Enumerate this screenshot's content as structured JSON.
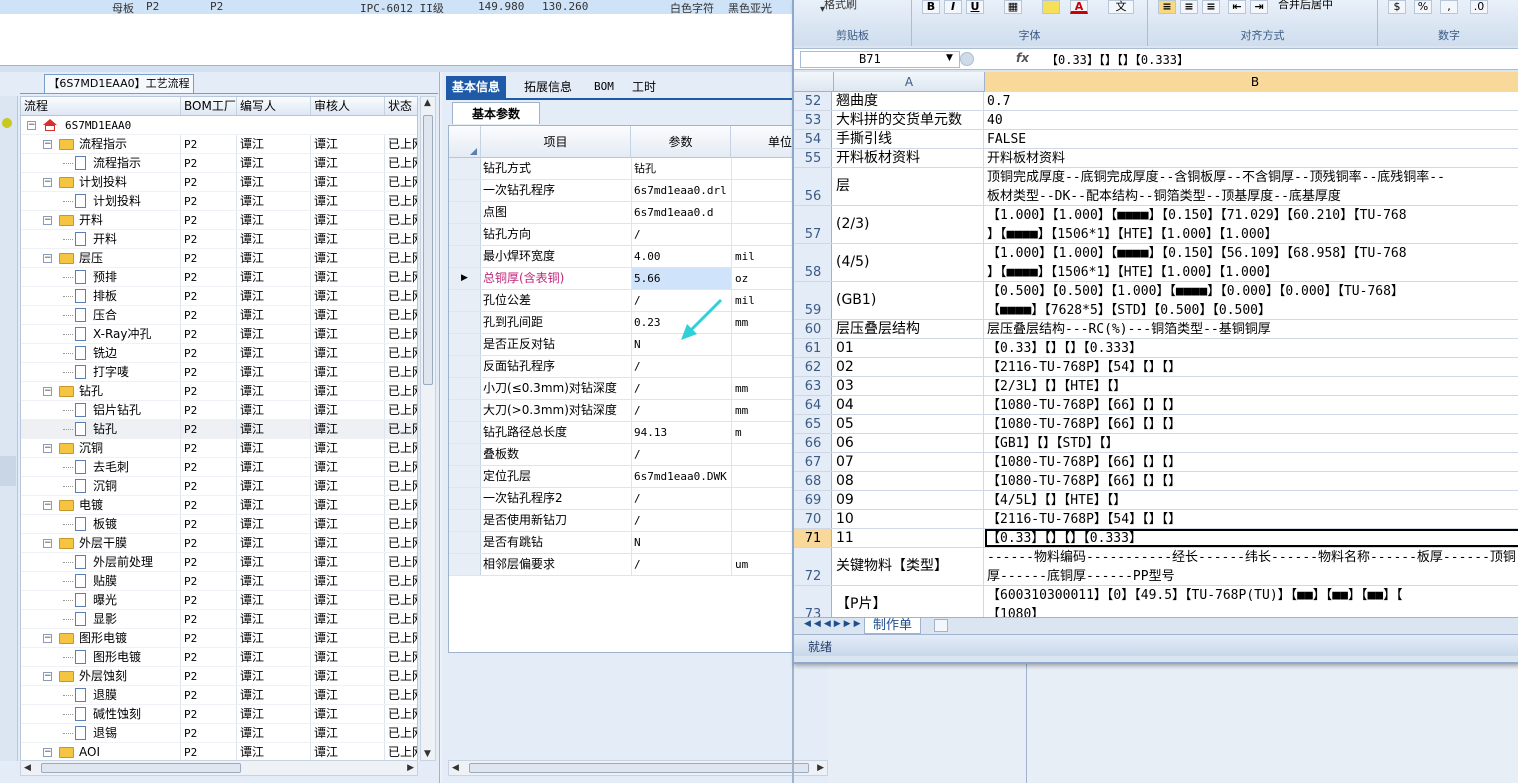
{
  "top_row": {
    "item": "母板",
    "c1": "P2",
    "c2": "P2",
    "spec": "IPC-6012 II级",
    "v1": "149.980",
    "v2": "130.260",
    "text1": "白色字符",
    "text2": "黑色亚光"
  },
  "left_panel": {
    "tab_title": "【6S7MD1EAA0】工艺流程",
    "headers": [
      "流程",
      "BOM工厂",
      "编写人",
      "审核人",
      "状态"
    ],
    "root": "6S7MD1EAA0",
    "rows": [
      {
        "name": "流程指示",
        "level": 1,
        "type": "folder",
        "bom": "P2",
        "writer": "谭江",
        "reviewer": "谭江",
        "status": "已上网"
      },
      {
        "name": "流程指示",
        "level": 2,
        "type": "doc",
        "bom": "P2",
        "writer": "谭江",
        "reviewer": "谭江",
        "status": "已上网"
      },
      {
        "name": "计划投料",
        "level": 1,
        "type": "folder",
        "bom": "P2",
        "writer": "谭江",
        "reviewer": "谭江",
        "status": "已上网"
      },
      {
        "name": "计划投料",
        "level": 2,
        "type": "doc",
        "bom": "P2",
        "writer": "谭江",
        "reviewer": "谭江",
        "status": "已上网"
      },
      {
        "name": "开料",
        "level": 1,
        "type": "folder",
        "bom": "P2",
        "writer": "谭江",
        "reviewer": "谭江",
        "status": "已上网"
      },
      {
        "name": "开料",
        "level": 2,
        "type": "doc",
        "bom": "P2",
        "writer": "谭江",
        "reviewer": "谭江",
        "status": "已上网"
      },
      {
        "name": "层压",
        "level": 1,
        "type": "folder",
        "bom": "P2",
        "writer": "谭江",
        "reviewer": "谭江",
        "status": "已上网"
      },
      {
        "name": "预排",
        "level": 2,
        "type": "doc",
        "bom": "P2",
        "writer": "谭江",
        "reviewer": "谭江",
        "status": "已上网"
      },
      {
        "name": "排板",
        "level": 2,
        "type": "doc",
        "bom": "P2",
        "writer": "谭江",
        "reviewer": "谭江",
        "status": "已上网"
      },
      {
        "name": "压合",
        "level": 2,
        "type": "doc",
        "bom": "P2",
        "writer": "谭江",
        "reviewer": "谭江",
        "status": "已上网"
      },
      {
        "name": "X-Ray冲孔",
        "level": 2,
        "type": "doc",
        "bom": "P2",
        "writer": "谭江",
        "reviewer": "谭江",
        "status": "已上网"
      },
      {
        "name": "铣边",
        "level": 2,
        "type": "doc",
        "bom": "P2",
        "writer": "谭江",
        "reviewer": "谭江",
        "status": "已上网"
      },
      {
        "name": "打字唛",
        "level": 2,
        "type": "doc",
        "bom": "P2",
        "writer": "谭江",
        "reviewer": "谭江",
        "status": "已上网"
      },
      {
        "name": "钻孔",
        "level": 1,
        "type": "folder",
        "bom": "P2",
        "writer": "谭江",
        "reviewer": "谭江",
        "status": "已上网"
      },
      {
        "name": "铝片钻孔",
        "level": 2,
        "type": "doc",
        "bom": "P2",
        "writer": "谭江",
        "reviewer": "谭江",
        "status": "已上网"
      },
      {
        "name": "钻孔",
        "level": 2,
        "type": "doc",
        "bom": "P2",
        "writer": "谭江",
        "reviewer": "谭江",
        "status": "已上网",
        "selected": true
      },
      {
        "name": "沉铜",
        "level": 1,
        "type": "folder",
        "bom": "P2",
        "writer": "谭江",
        "reviewer": "谭江",
        "status": "已上网"
      },
      {
        "name": "去毛刺",
        "level": 2,
        "type": "doc",
        "bom": "P2",
        "writer": "谭江",
        "reviewer": "谭江",
        "status": "已上网"
      },
      {
        "name": "沉铜",
        "level": 2,
        "type": "doc",
        "bom": "P2",
        "writer": "谭江",
        "reviewer": "谭江",
        "status": "已上网"
      },
      {
        "name": "电镀",
        "level": 1,
        "type": "folder",
        "bom": "P2",
        "writer": "谭江",
        "reviewer": "谭江",
        "status": "已上网"
      },
      {
        "name": "板镀",
        "level": 2,
        "type": "doc",
        "bom": "P2",
        "writer": "谭江",
        "reviewer": "谭江",
        "status": "已上网"
      },
      {
        "name": "外层干膜",
        "level": 1,
        "type": "folder",
        "bom": "P2",
        "writer": "谭江",
        "reviewer": "谭江",
        "status": "已上网"
      },
      {
        "name": "外层前处理",
        "level": 2,
        "type": "doc",
        "bom": "P2",
        "writer": "谭江",
        "reviewer": "谭江",
        "status": "已上网"
      },
      {
        "name": "贴膜",
        "level": 2,
        "type": "doc",
        "bom": "P2",
        "writer": "谭江",
        "reviewer": "谭江",
        "status": "已上网"
      },
      {
        "name": "曝光",
        "level": 2,
        "type": "doc",
        "bom": "P2",
        "writer": "谭江",
        "reviewer": "谭江",
        "status": "已上网"
      },
      {
        "name": "显影",
        "level": 2,
        "type": "doc",
        "bom": "P2",
        "writer": "谭江",
        "reviewer": "谭江",
        "status": "已上网"
      },
      {
        "name": "图形电镀",
        "level": 1,
        "type": "folder",
        "bom": "P2",
        "writer": "谭江",
        "reviewer": "谭江",
        "status": "已上网"
      },
      {
        "name": "图形电镀",
        "level": 2,
        "type": "doc",
        "bom": "P2",
        "writer": "谭江",
        "reviewer": "谭江",
        "status": "已上网"
      },
      {
        "name": "外层蚀刻",
        "level": 1,
        "type": "folder",
        "bom": "P2",
        "writer": "谭江",
        "reviewer": "谭江",
        "status": "已上网"
      },
      {
        "name": "退膜",
        "level": 2,
        "type": "doc",
        "bom": "P2",
        "writer": "谭江",
        "reviewer": "谭江",
        "status": "已上网"
      },
      {
        "name": "碱性蚀刻",
        "level": 2,
        "type": "doc",
        "bom": "P2",
        "writer": "谭江",
        "reviewer": "谭江",
        "status": "已上网"
      },
      {
        "name": "退锡",
        "level": 2,
        "type": "doc",
        "bom": "P2",
        "writer": "谭江",
        "reviewer": "谭江",
        "status": "已上网"
      },
      {
        "name": "AOI",
        "level": 1,
        "type": "folder",
        "bom": "P2",
        "writer": "谭江",
        "reviewer": "谭江",
        "status": "已上网"
      }
    ]
  },
  "mid_panel": {
    "tabs": [
      "基本信息",
      "拓展信息",
      "BOM",
      "工时"
    ],
    "active_tab": 0,
    "subtab": "基本参数",
    "headers": [
      "项目",
      "参数",
      "单位"
    ],
    "rows": [
      {
        "item": "钻孔方式",
        "value": "钻孔",
        "unit": ""
      },
      {
        "item": "一次钻孔程序",
        "value": "6s7md1eaa0.drl",
        "unit": ""
      },
      {
        "item": "点图",
        "value": "6s7md1eaa0.d",
        "unit": ""
      },
      {
        "item": "钻孔方向",
        "value": "/",
        "unit": ""
      },
      {
        "item": "最小焊环宽度",
        "value": "4.00",
        "unit": "mil"
      },
      {
        "item": "总铜厚(含表铜)",
        "value": "5.66",
        "unit": "oz",
        "current": true
      },
      {
        "item": "孔位公差",
        "value": "/",
        "unit": "mil"
      },
      {
        "item": "孔到孔间距",
        "value": "0.23",
        "unit": "mm"
      },
      {
        "item": "是否正反对钻",
        "value": "N",
        "unit": ""
      },
      {
        "item": "反面钻孔程序",
        "value": "/",
        "unit": ""
      },
      {
        "item": "小刀(≤0.3mm)对钻深度",
        "value": "/",
        "unit": "mm"
      },
      {
        "item": "大刀(>0.3mm)对钻深度",
        "value": "/",
        "unit": "mm"
      },
      {
        "item": "钻孔路径总长度",
        "value": "94.13",
        "unit": "m"
      },
      {
        "item": "叠板数",
        "value": "/",
        "unit": ""
      },
      {
        "item": "定位孔层",
        "value": "6s7md1eaa0.DWK",
        "unit": ""
      },
      {
        "item": "一次钻孔程序2",
        "value": "/",
        "unit": ""
      },
      {
        "item": "是否使用新钻刀",
        "value": "/",
        "unit": ""
      },
      {
        "item": "是否有跳钻",
        "value": "N",
        "unit": ""
      },
      {
        "item": "相邻层偏要求",
        "value": "/",
        "unit": "um"
      }
    ]
  },
  "excel": {
    "ribbon_groups": [
      "剪贴板",
      "字体",
      "对齐方式",
      "数字"
    ],
    "format_painter": "格式刷",
    "merge_center": "合并后居中",
    "font_buttons": [
      "B",
      "I",
      "U"
    ],
    "name_box": "B71",
    "fx": "fx",
    "formula": "【0.33】【】【】【0.333】",
    "columns": [
      "A",
      "B"
    ],
    "rows": [
      {
        "n": "52",
        "a": "翘曲度",
        "b": [
          "0.7"
        ]
      },
      {
        "n": "53",
        "a": "大料拼的交货单元数",
        "b": [
          "40"
        ]
      },
      {
        "n": "54",
        "a": "手撕引线",
        "b": [
          "FALSE"
        ]
      },
      {
        "n": "55",
        "a": "开料板材资料",
        "b": [
          "开料板材资料"
        ]
      },
      {
        "n": "56",
        "a": "层",
        "b": [
          "顶铜完成厚度--底铜完成厚度--含铜板厚--不含铜厚--顶残铜率--底残铜率--",
          "板材类型--DK--配本结构--铜箔类型--顶基厚度--底基厚度"
        ]
      },
      {
        "n": "57",
        "a": "(2/3)",
        "b": [
          "【1.000】【1.000】【■■■■】【0.150】【71.029】【60.210】【TU-768",
          "】【■■■■】【1506*1】【HTE】【1.000】【1.000】"
        ]
      },
      {
        "n": "58",
        "a": "(4/5)",
        "b": [
          "【1.000】【1.000】【■■■■】【0.150】【56.109】【68.958】【TU-768",
          "】【■■■■】【1506*1】【HTE】【1.000】【1.000】"
        ]
      },
      {
        "n": "59",
        "a": "(GB1)",
        "b": [
          "【0.500】【0.500】【1.000】【■■■■】【0.000】【0.000】【TU-768】",
          "【■■■■】【7628*5】【STD】【0.500】【0.500】"
        ]
      },
      {
        "n": "60",
        "a": "层压叠层结构",
        "b": [
          "层压叠层结构---RC(%)---铜箔类型--基铜铜厚"
        ]
      },
      {
        "n": "61",
        "a": "01",
        "b": [
          "【0.33】【】【】【0.333】"
        ]
      },
      {
        "n": "62",
        "a": "02",
        "b": [
          "【2116-TU-768P】【54】【】【】"
        ]
      },
      {
        "n": "63",
        "a": "03",
        "b": [
          "【2/3L】【】【HTE】【】"
        ]
      },
      {
        "n": "64",
        "a": "04",
        "b": [
          "【1080-TU-768P】【66】【】【】"
        ]
      },
      {
        "n": "65",
        "a": "05",
        "b": [
          "【1080-TU-768P】【66】【】【】"
        ]
      },
      {
        "n": "66",
        "a": "06",
        "b": [
          "【GB1】【】【STD】【】"
        ]
      },
      {
        "n": "67",
        "a": "07",
        "b": [
          "【1080-TU-768P】【66】【】【】"
        ]
      },
      {
        "n": "68",
        "a": "08",
        "b": [
          "【1080-TU-768P】【66】【】【】"
        ]
      },
      {
        "n": "69",
        "a": "09",
        "b": [
          "【4/5L】【】【HTE】【】"
        ]
      },
      {
        "n": "70",
        "a": "10",
        "b": [
          "【2116-TU-768P】【54】【】【】"
        ]
      },
      {
        "n": "71",
        "a": "11",
        "b": [
          "【0.33】【】【】【0.333】"
        ],
        "current": true
      },
      {
        "n": "72",
        "a": "关键物料【类型】",
        "b": [
          "------物料编码-----------经长------纬长------物料名称------板厚------顶铜",
          "厚------底铜厚------PP型号"
        ]
      },
      {
        "n": "73",
        "a": "【P片】",
        "b": [
          "【600310300011】【0】【49.5】【TU-768P(TU)】【■■】【■■】【■■】【",
          "【1080】"
        ]
      }
    ],
    "sheet_tab": "制作单",
    "status": "就绪"
  }
}
